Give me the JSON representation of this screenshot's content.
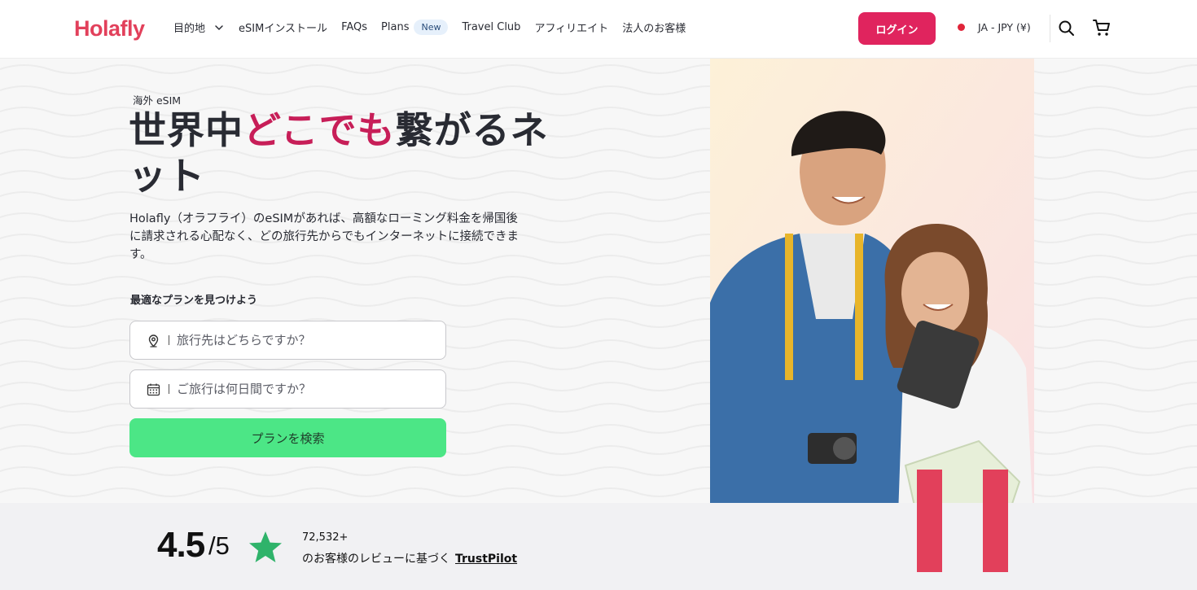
{
  "header": {
    "logo": "Holafly",
    "nav": {
      "destinations": "目的地",
      "install": "eSIMインストール",
      "faqs": "FAQs",
      "plans": "Plans",
      "plans_badge": "New",
      "travel_club": "Travel Club",
      "affiliate": "アフィリエイト",
      "business": "法人のお客様"
    },
    "login": "ログイン",
    "language": "JA - JPY (¥)"
  },
  "hero": {
    "eyebrow": "海外 eSIM",
    "headline_before": "世界中",
    "headline_accent": "どこでも",
    "headline_after": "繋がるネット",
    "description": "Holafly（オラフライ）のeSIMがあれば、高額なローミング料金を帰国後に請求される心配なく、どの旅行先からでもインターネットに接続できます。",
    "finder_label": "最適なプランを見つけよう",
    "destination_placeholder": "旅行先はどちらですか？",
    "duration_placeholder": "ご旅行は何日間ですか？",
    "search_button": "プランを検索"
  },
  "trust": {
    "score": "4.5",
    "score_denominator": "/5",
    "review_count": "72,532+",
    "based_on": "のお客様のレビューに基づく",
    "provider": "TrustPilot"
  },
  "colors": {
    "brand": "#e2405b",
    "login": "#e0245e",
    "accent_text": "#c71e58",
    "cta": "#4ce686",
    "star": "#2fb36a"
  },
  "icons": [
    "chevron-down-icon",
    "search-icon",
    "cart-icon",
    "location-pin-icon",
    "calendar-icon",
    "star-icon"
  ]
}
